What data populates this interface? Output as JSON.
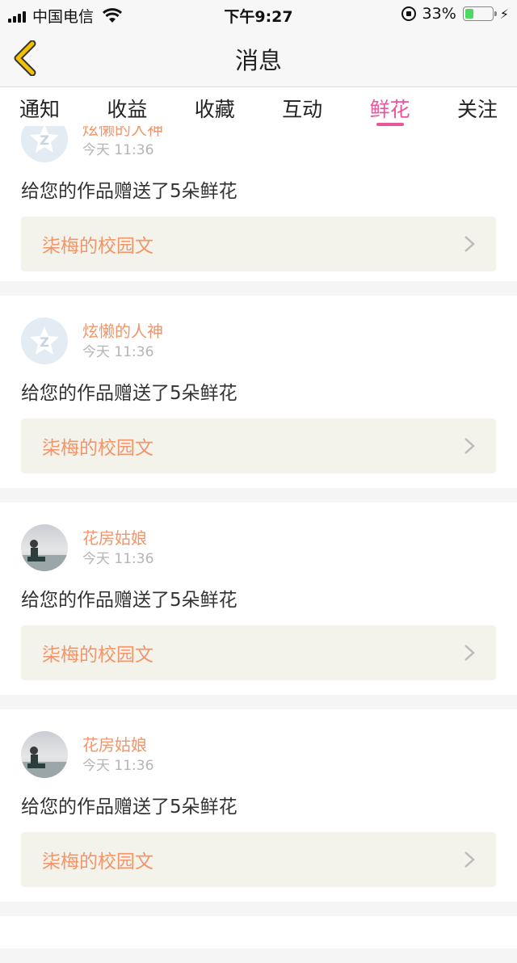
{
  "status_bar": {
    "carrier": "中国电信",
    "time": "下午9:27",
    "battery_percent_text": "33%",
    "battery_level": 0.33
  },
  "nav": {
    "title": "消息"
  },
  "tabs": [
    {
      "label": "通知",
      "active": false
    },
    {
      "label": "收益",
      "active": false
    },
    {
      "label": "收藏",
      "active": false
    },
    {
      "label": "互动",
      "active": false
    },
    {
      "label": "鲜花",
      "active": true
    },
    {
      "label": "关注",
      "active": false
    }
  ],
  "messages": [
    {
      "user": "炫懒的人神",
      "time": "今天 11:36",
      "text": "给您的作品赠送了5朵鲜花",
      "work": "柒梅的校园文",
      "avatar": "default-avatar-icon"
    },
    {
      "user": "炫懒的人神",
      "time": "今天 11:36",
      "text": "给您的作品赠送了5朵鲜花",
      "work": "柒梅的校园文",
      "avatar": "default-avatar-icon"
    },
    {
      "user": "花房姑娘",
      "time": "今天 11:36",
      "text": "给您的作品赠送了5朵鲜花",
      "work": "柒梅的校园文",
      "avatar": "photo-avatar"
    },
    {
      "user": "花房姑娘",
      "time": "今天 11:36",
      "text": "给您的作品赠送了5朵鲜花",
      "work": "柒梅的校园文",
      "avatar": "photo-avatar"
    }
  ],
  "colors": {
    "accent_pink": "#e8579b",
    "name_orange": "#f0966a",
    "link_bg": "#f3f3ec",
    "back_arrow": "#f2c200"
  }
}
